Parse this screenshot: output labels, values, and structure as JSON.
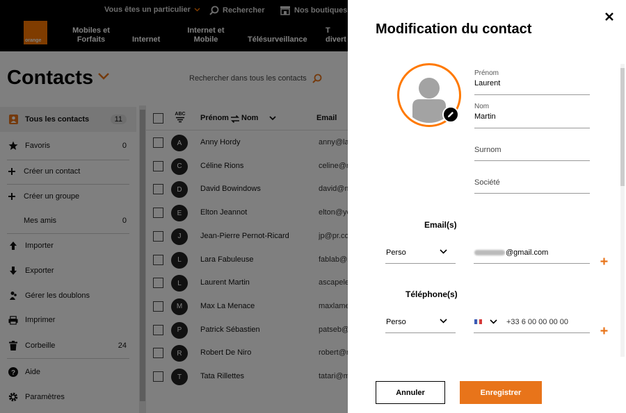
{
  "topbar": {
    "particulier": "Vous êtes un particulier",
    "rechercher": "Rechercher",
    "boutiques": "Nos boutiques",
    "logo_text": "orange",
    "nav": [
      "Mobiles et Forfaits",
      "Internet",
      "Internet et Mobile",
      "Télésurveillance",
      "T diverti"
    ]
  },
  "header": {
    "title": "Contacts",
    "search_all": "Rechercher dans tous les contacts"
  },
  "sidebar": {
    "items": [
      {
        "label": "Tous les contacts",
        "count": "11",
        "icon": "contact-card-icon"
      },
      {
        "label": "Favoris",
        "count": "0",
        "icon": "star-icon"
      },
      {
        "label": "Créer un contact",
        "count": "",
        "icon": "plus-icon"
      },
      {
        "label": "Créer un groupe",
        "count": "",
        "icon": "plus-icon"
      },
      {
        "label": "Mes amis",
        "count": "0",
        "icon": ""
      },
      {
        "label": "Importer",
        "count": "",
        "icon": "arrow-up-icon"
      },
      {
        "label": "Exporter",
        "count": "",
        "icon": "arrow-down-icon"
      },
      {
        "label": "Gérer les doublons",
        "count": "",
        "icon": "duplicate-users-icon"
      },
      {
        "label": "Imprimer",
        "count": "",
        "icon": "printer-icon"
      },
      {
        "label": "Corbeille",
        "count": "24",
        "icon": "trash-icon"
      },
      {
        "label": "Aide",
        "count": "",
        "icon": "help-icon"
      },
      {
        "label": "Paramètres",
        "count": "",
        "icon": "gear-icon"
      }
    ]
  },
  "list": {
    "abc": "ABC",
    "col_prenom": "Prénom",
    "col_nom": "Nom",
    "col_email": "Email",
    "rows": [
      {
        "initial": "A",
        "name": "Anny Hordy",
        "email": "anny@la"
      },
      {
        "initial": "C",
        "name": "Céline Rions",
        "email": "celine@r"
      },
      {
        "initial": "D",
        "name": "David Bowindows",
        "email": "david@m"
      },
      {
        "initial": "E",
        "name": "Elton Jeannot",
        "email": "elton@ye"
      },
      {
        "initial": "J",
        "name": "Jean-Pierre Pernot-Ricard",
        "email": "jp@pr.co"
      },
      {
        "initial": "L",
        "name": "Lara Fabuleuse",
        "email": "fablab@r"
      },
      {
        "initial": "L",
        "name": "Laurent Martin",
        "email": "ascapele"
      },
      {
        "initial": "M",
        "name": "Max La Menace",
        "email": "maxlame"
      },
      {
        "initial": "P",
        "name": "Patrick Sébastien",
        "email": "patseb@"
      },
      {
        "initial": "R",
        "name": "Robert De Niro",
        "email": "robert@r"
      },
      {
        "initial": "T",
        "name": "Tata Rillettes",
        "email": "tatari@m"
      }
    ]
  },
  "modal": {
    "title": "Modification du contact",
    "prenom_label": "Prénom",
    "prenom_value": "Laurent",
    "nom_label": "Nom",
    "nom_value": "Martin",
    "surnom_placeholder": "Surnom",
    "societe_placeholder": "Société",
    "emails_title": "Email(s)",
    "email_type": "Perso",
    "email_value": "@gmail.com",
    "phones_title": "Téléphone(s)",
    "phone_type": "Perso",
    "phone_value": "+33 6 00 00 00 00",
    "cancel_label": "Annuler",
    "save_label": "Enregistrer"
  },
  "colors": {
    "accent": "#e8741a",
    "brand": "#ff7900",
    "topbar": "#000000"
  }
}
